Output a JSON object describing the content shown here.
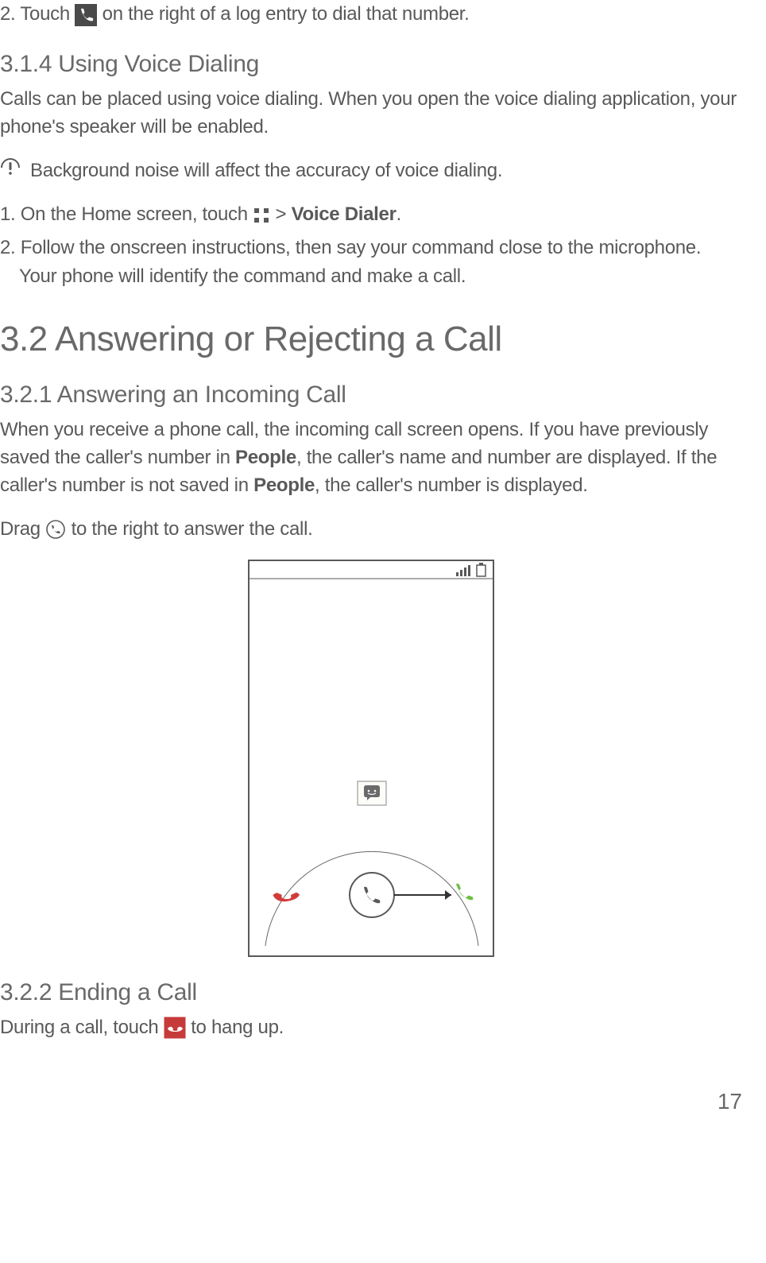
{
  "step2_touch": {
    "prefix": "2. Touch ",
    "suffix": " on the right of a log entry to dial that number."
  },
  "section_3_1_4": "3.1.4  Using Voice Dialing",
  "voice_dialing_intro": "Calls can be placed using voice dialing. When you open the voice dialing application, your phone's speaker will be enabled.",
  "tip_noise": "Background noise will affect the accuracy of voice dialing.",
  "step1_home": {
    "prefix": "1. On the Home screen, touch ",
    "gt": " > ",
    "voice_dialer": "Voice Dialer",
    "period": "."
  },
  "step2_follow": "2. Follow the onscreen instructions, then say your command close to the microphone. Your phone will identify the command and make a call.",
  "step2_follow_indent": "Your phone will identify the command and make a call.",
  "section_3_2": "3.2  Answering or Rejecting a Call",
  "section_3_2_1": "3.2.1  Answering an Incoming Call",
  "incoming_text_pre": "When you receive a phone call, the incoming call screen opens. If you have previously saved the caller's number in ",
  "bold_people": "People",
  "incoming_text_mid": ", the caller's name and number are displayed. If the caller's number is not saved in ",
  "incoming_text_post": ", the caller's number is displayed.",
  "drag_prefix": "Drag ",
  "drag_suffix": " to the right to answer the call.",
  "section_3_2_2": "3.2.2  Ending a Call",
  "ending_prefix": "During a call, touch ",
  "ending_suffix": " to hang up.",
  "page_number": "17"
}
